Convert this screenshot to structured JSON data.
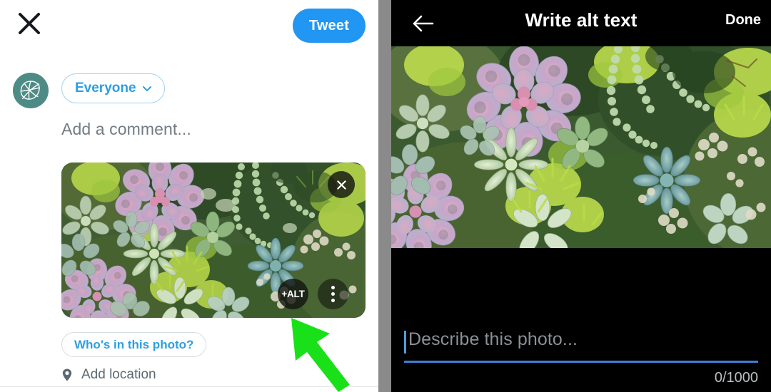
{
  "compose": {
    "close_icon": "close-x-icon",
    "tweet_label": "Tweet",
    "avatar_icon": "leaf-avatar-icon",
    "audience_label": "Everyone",
    "audience_chevron": "chevron-down-icon",
    "comment_placeholder": "Add a comment...",
    "photo": {
      "remove_icon": "close-icon",
      "alt_badge_label": "+ALT",
      "more_icon": "three-dot-menu-icon",
      "description": "succulent garden photo"
    },
    "whos_in_photo_label": "Who's in this photo?",
    "location_icon": "location-pin-icon",
    "location_label": "Add location"
  },
  "pointer": {
    "name": "green-arrow-cursor",
    "color": "#1ae01a"
  },
  "alt_screen": {
    "back_icon": "arrow-left-icon",
    "title": "Write alt text",
    "done_label": "Done",
    "photo_description": "succulent garden photo",
    "describe_placeholder": "Describe this photo...",
    "describe_value": "",
    "counter": "0/1000"
  },
  "colors": {
    "twitter_blue": "#2196f3",
    "link_blue": "#2d9fe0",
    "avatar_teal": "#4e8b86",
    "alt_bg": "#000000",
    "divider_grey": "#8a8a8a",
    "underline_blue": "#3d7fd6",
    "pointer_green": "#1ae01a"
  }
}
